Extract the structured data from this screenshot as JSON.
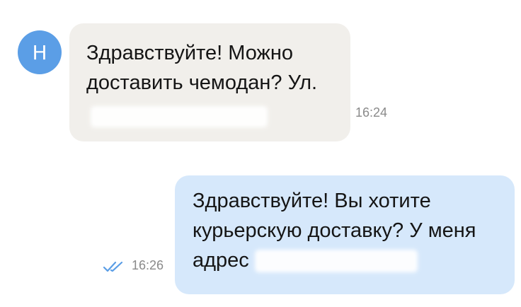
{
  "incoming": {
    "avatar_letter": "H",
    "lines": [
      "Здравствуйте! Можно",
      "доставить чемодан? Ул."
    ],
    "time": "16:24"
  },
  "outgoing": {
    "lines": [
      "Здравствуйте! Вы хотите",
      "курьерскую доставку? У меня",
      "адрес"
    ],
    "time": "16:26",
    "status_icon": "double-check-icon",
    "status_color": "#5b9ee6"
  },
  "colors": {
    "avatar": "#5b9ee6",
    "incoming_bubble": "#f1efeb",
    "outgoing_bubble": "#d6e8fb"
  }
}
